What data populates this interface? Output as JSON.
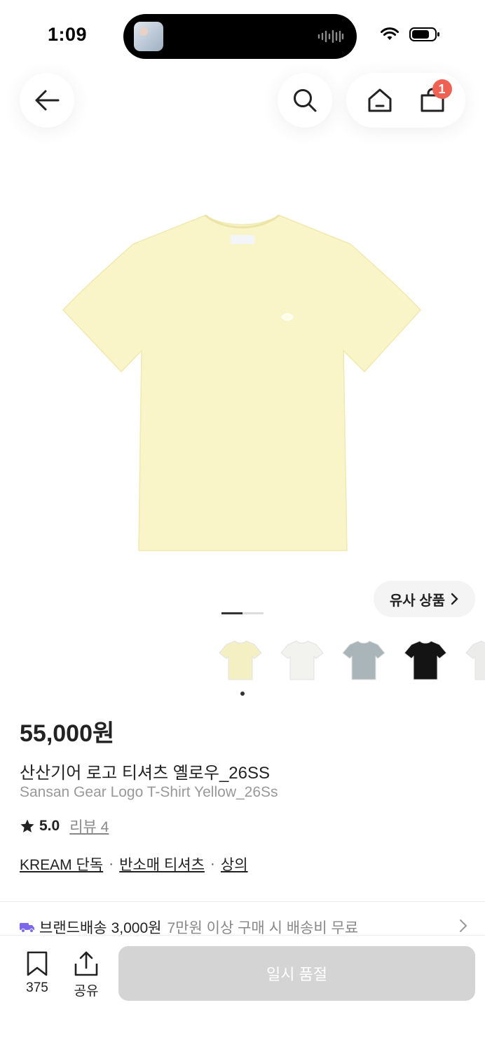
{
  "status_bar": {
    "time": "1:09"
  },
  "nav": {
    "cart_count": "1"
  },
  "similar_button": {
    "label": "유사 상품"
  },
  "pager": {
    "active_index": 0,
    "count": 2
  },
  "thumbnails": [
    {
      "name": "thumb-yellow",
      "color": "#f5f0c4"
    },
    {
      "name": "thumb-white",
      "color": "#f2f2ef"
    },
    {
      "name": "thumb-gray",
      "color": "#a9b5b8"
    },
    {
      "name": "thumb-black",
      "color": "#141414"
    },
    {
      "name": "thumb-light",
      "color": "#ececea"
    }
  ],
  "product": {
    "price": "55,000원",
    "name_ko": "산산기어 로고 티셔츠 옐로우_26SS",
    "name_en": "Sansan Gear Logo T-Shirt Yellow_26Ss",
    "rating": "5.0",
    "review_label": "리뷰 4",
    "tags": [
      "KREAM 단독",
      "반소매 티셔츠",
      "상의"
    ],
    "tag_separator": "·",
    "image_color": "#faf5c8"
  },
  "delivery": {
    "label": "브랜드배송",
    "fee": "3,000원",
    "note": "7만원 이상 구매 시 배송비 무료",
    "icon_color": "#7b68ee"
  },
  "bottom_bar": {
    "bookmark_count": "375",
    "share_label": "공유",
    "buy_label": "일시 품절"
  }
}
